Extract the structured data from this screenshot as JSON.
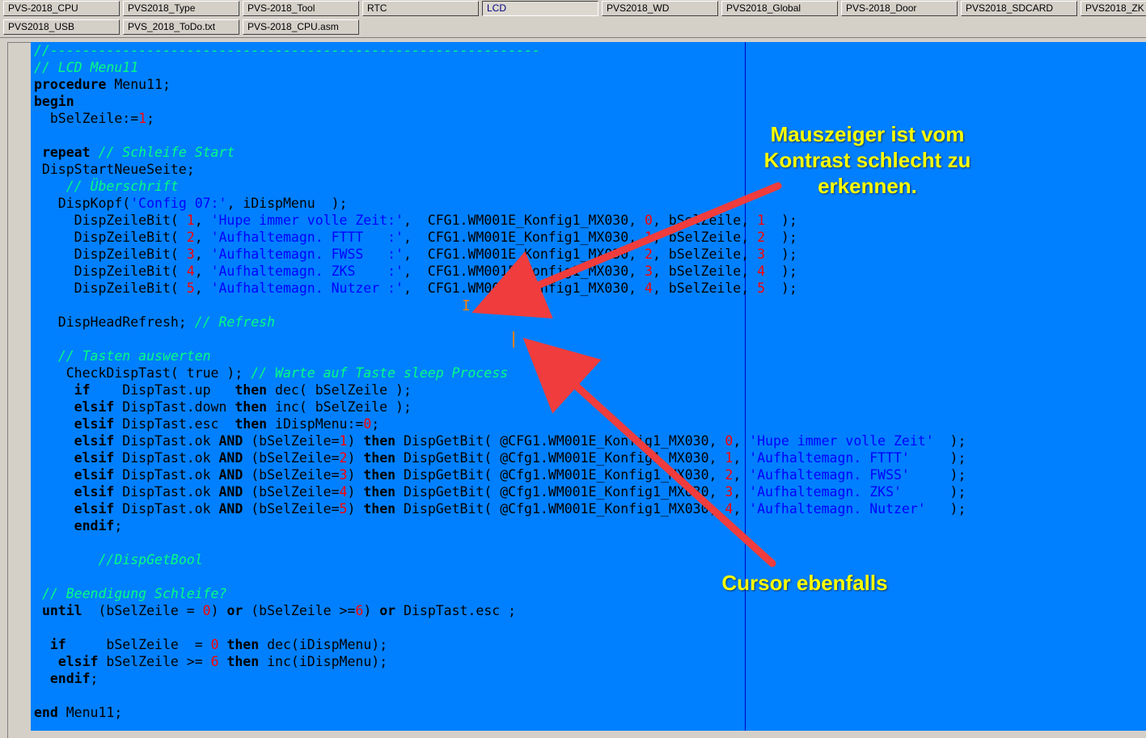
{
  "tabs_row1": [
    "PVS-2018_CPU",
    "PVS2018_Type",
    "PVS-2018_Tool",
    "RTC",
    "LCD",
    "PVS2018_WD",
    "PVS2018_Global",
    "PVS-2018_Door",
    "PVS2018_SDCARD",
    "PVS2018_ZK"
  ],
  "tabs_row2": [
    "PVS2018_USB",
    "PVS_2018_ToDo.txt",
    "PVS-2018_CPU.asm"
  ],
  "active_tab": "LCD",
  "code_lines": [
    [
      [
        "cm",
        "//-------------------------------------------------------------"
      ]
    ],
    [
      [
        "cm",
        "// LCD Menu11"
      ]
    ],
    [
      [
        "kw",
        "procedure"
      ],
      [
        "t",
        " Menu11;"
      ]
    ],
    [
      [
        "kw",
        "begin"
      ]
    ],
    [
      [
        "t",
        "  bSelZeile:="
      ],
      [
        "nm",
        "1"
      ],
      [
        "t",
        ";"
      ]
    ],
    [
      [
        "t",
        ""
      ]
    ],
    [
      [
        "t",
        " "
      ],
      [
        "kw",
        "repeat"
      ],
      [
        "t",
        " "
      ],
      [
        "cm",
        "// Schleife Start"
      ]
    ],
    [
      [
        "t",
        " DispStartNeueSeite;"
      ]
    ],
    [
      [
        "t",
        "    "
      ],
      [
        "cm",
        "// Überschrift"
      ]
    ],
    [
      [
        "t",
        "   DispKopf("
      ],
      [
        "st",
        "'Config 07:'"
      ],
      [
        "t",
        ", iDispMenu  );"
      ]
    ],
    [
      [
        "t",
        "     DispZeileBit( "
      ],
      [
        "nm",
        "1"
      ],
      [
        "t",
        ", "
      ],
      [
        "st",
        "'Hupe immer volle Zeit:'"
      ],
      [
        "t",
        ",  CFG1.WM001E_Konfig1_MX030, "
      ],
      [
        "nm",
        "0"
      ],
      [
        "t",
        ", bSelZeile, "
      ],
      [
        "nm",
        "1"
      ],
      [
        "t",
        "  );"
      ]
    ],
    [
      [
        "t",
        "     DispZeileBit( "
      ],
      [
        "nm",
        "2"
      ],
      [
        "t",
        ", "
      ],
      [
        "st",
        "'Aufhaltemagn. FTTT   :'"
      ],
      [
        "t",
        ",  CFG1.WM001E_Konfig1_MX030, "
      ],
      [
        "nm",
        "1"
      ],
      [
        "t",
        ", bSelZeile, "
      ],
      [
        "nm",
        "2"
      ],
      [
        "t",
        "  );"
      ]
    ],
    [
      [
        "t",
        "     DispZeileBit( "
      ],
      [
        "nm",
        "3"
      ],
      [
        "t",
        ", "
      ],
      [
        "st",
        "'Aufhaltemagn. FWSS   :'"
      ],
      [
        "t",
        ",  CFG1.WM001E_Konfig1_MX030, "
      ],
      [
        "nm",
        "2"
      ],
      [
        "t",
        ", bSelZeile, "
      ],
      [
        "nm",
        "3"
      ],
      [
        "t",
        "  );"
      ]
    ],
    [
      [
        "t",
        "     DispZeileBit( "
      ],
      [
        "nm",
        "4"
      ],
      [
        "t",
        ", "
      ],
      [
        "st",
        "'Aufhaltemagn. ZKS    :'"
      ],
      [
        "t",
        ",  CFG1.WM001E_Konfig1_MX030, "
      ],
      [
        "nm",
        "3"
      ],
      [
        "t",
        ", bSelZeile, "
      ],
      [
        "nm",
        "4"
      ],
      [
        "t",
        "  );"
      ]
    ],
    [
      [
        "t",
        "     DispZeileBit( "
      ],
      [
        "nm",
        "5"
      ],
      [
        "t",
        ", "
      ],
      [
        "st",
        "'Aufhaltemagn. Nutzer :'"
      ],
      [
        "t",
        ",  CFG1.WM001E_Konfig1_MX030, "
      ],
      [
        "nm",
        "4"
      ],
      [
        "t",
        ", bSelZeile, "
      ],
      [
        "nm",
        "5"
      ],
      [
        "t",
        "  );"
      ]
    ],
    [
      [
        "t",
        ""
      ]
    ],
    [
      [
        "t",
        "   DispHeadRefresh; "
      ],
      [
        "cm",
        "// Refresh"
      ]
    ],
    [
      [
        "t",
        ""
      ]
    ],
    [
      [
        "t",
        "   "
      ],
      [
        "cm",
        "// Tasten auswerten"
      ]
    ],
    [
      [
        "t",
        "    CheckDispTast( true ); "
      ],
      [
        "cm",
        "// Warte auf Taste sleep Process"
      ]
    ],
    [
      [
        "t",
        "     "
      ],
      [
        "kw",
        "if"
      ],
      [
        "t",
        "    DispTast.up   "
      ],
      [
        "kw",
        "then"
      ],
      [
        "t",
        " dec( bSelZeile );"
      ]
    ],
    [
      [
        "t",
        "     "
      ],
      [
        "kw",
        "elsif"
      ],
      [
        "t",
        " DispTast.down "
      ],
      [
        "kw",
        "then"
      ],
      [
        "t",
        " inc( bSelZeile );"
      ]
    ],
    [
      [
        "t",
        "     "
      ],
      [
        "kw",
        "elsif"
      ],
      [
        "t",
        " DispTast.esc  "
      ],
      [
        "kw",
        "then"
      ],
      [
        "t",
        " iDispMenu:="
      ],
      [
        "nm",
        "0"
      ],
      [
        "t",
        ";"
      ]
    ],
    [
      [
        "t",
        "     "
      ],
      [
        "kw",
        "elsif"
      ],
      [
        "t",
        " DispTast.ok "
      ],
      [
        "kw",
        "AND"
      ],
      [
        "t",
        " (bSelZeile="
      ],
      [
        "nm",
        "1"
      ],
      [
        "t",
        ") "
      ],
      [
        "kw",
        "then"
      ],
      [
        "t",
        " DispGetBit( @CFG1.WM001E_Konfig1_MX030, "
      ],
      [
        "nm",
        "0"
      ],
      [
        "t",
        ", "
      ],
      [
        "st",
        "'Hupe immer volle Zeit'"
      ],
      [
        "t",
        "  );"
      ]
    ],
    [
      [
        "t",
        "     "
      ],
      [
        "kw",
        "elsif"
      ],
      [
        "t",
        " DispTast.ok "
      ],
      [
        "kw",
        "AND"
      ],
      [
        "t",
        " (bSelZeile="
      ],
      [
        "nm",
        "2"
      ],
      [
        "t",
        ") "
      ],
      [
        "kw",
        "then"
      ],
      [
        "t",
        " DispGetBit( @Cfg1.WM001E_Konfig1_MX030, "
      ],
      [
        "nm",
        "1"
      ],
      [
        "t",
        ", "
      ],
      [
        "st",
        "'Aufhaltemagn. FTTT'"
      ],
      [
        "t",
        "     );"
      ]
    ],
    [
      [
        "t",
        "     "
      ],
      [
        "kw",
        "elsif"
      ],
      [
        "t",
        " DispTast.ok "
      ],
      [
        "kw",
        "AND"
      ],
      [
        "t",
        " (bSelZeile="
      ],
      [
        "nm",
        "3"
      ],
      [
        "t",
        ") "
      ],
      [
        "kw",
        "then"
      ],
      [
        "t",
        " DispGetBit( @Cfg1.WM001E_Konfig1_MX030, "
      ],
      [
        "nm",
        "2"
      ],
      [
        "t",
        ", "
      ],
      [
        "st",
        "'Aufhaltemagn. FWSS'"
      ],
      [
        "t",
        "     );"
      ]
    ],
    [
      [
        "t",
        "     "
      ],
      [
        "kw",
        "elsif"
      ],
      [
        "t",
        " DispTast.ok "
      ],
      [
        "kw",
        "AND"
      ],
      [
        "t",
        " (bSelZeile="
      ],
      [
        "nm",
        "4"
      ],
      [
        "t",
        ") "
      ],
      [
        "kw",
        "then"
      ],
      [
        "t",
        " DispGetBit( @Cfg1.WM001E_Konfig1_MX030, "
      ],
      [
        "nm",
        "3"
      ],
      [
        "t",
        ", "
      ],
      [
        "st",
        "'Aufhaltemagn. ZKS'"
      ],
      [
        "t",
        "      );"
      ]
    ],
    [
      [
        "t",
        "     "
      ],
      [
        "kw",
        "elsif"
      ],
      [
        "t",
        " DispTast.ok "
      ],
      [
        "kw",
        "AND"
      ],
      [
        "t",
        " (bSelZeile="
      ],
      [
        "nm",
        "5"
      ],
      [
        "t",
        ") "
      ],
      [
        "kw",
        "then"
      ],
      [
        "t",
        " DispGetBit( @Cfg1.WM001E_Konfig1_MX030, "
      ],
      [
        "nm",
        "4"
      ],
      [
        "t",
        ", "
      ],
      [
        "st",
        "'Aufhaltemagn. Nutzer'"
      ],
      [
        "t",
        "   );"
      ]
    ],
    [
      [
        "t",
        "     "
      ],
      [
        "kw",
        "endif"
      ],
      [
        "t",
        ";"
      ]
    ],
    [
      [
        "t",
        ""
      ]
    ],
    [
      [
        "t",
        "        "
      ],
      [
        "cm",
        "//DispGetBool"
      ]
    ],
    [
      [
        "t",
        ""
      ]
    ],
    [
      [
        "t",
        " "
      ],
      [
        "cm",
        "// Beendigung Schleife?"
      ]
    ],
    [
      [
        "t",
        " "
      ],
      [
        "kw",
        "until"
      ],
      [
        "t",
        "  (bSelZeile = "
      ],
      [
        "nm",
        "0"
      ],
      [
        "t",
        ") "
      ],
      [
        "kw",
        "or"
      ],
      [
        "t",
        " (bSelZeile >="
      ],
      [
        "nm",
        "6"
      ],
      [
        "t",
        ") "
      ],
      [
        "kw",
        "or"
      ],
      [
        "t",
        " DispTast.esc ;"
      ]
    ],
    [
      [
        "t",
        ""
      ]
    ],
    [
      [
        "t",
        "  "
      ],
      [
        "kw",
        "if"
      ],
      [
        "t",
        "     bSelZeile  = "
      ],
      [
        "nm",
        "0"
      ],
      [
        "t",
        " "
      ],
      [
        "kw",
        "then"
      ],
      [
        "t",
        " dec(iDispMenu);"
      ]
    ],
    [
      [
        "t",
        "   "
      ],
      [
        "kw",
        "elsif"
      ],
      [
        "t",
        " bSelZeile >= "
      ],
      [
        "nm",
        "6"
      ],
      [
        "t",
        " "
      ],
      [
        "kw",
        "then"
      ],
      [
        "t",
        " inc(iDispMenu);"
      ]
    ],
    [
      [
        "t",
        "  "
      ],
      [
        "kw",
        "endif"
      ],
      [
        "t",
        ";"
      ]
    ],
    [
      [
        "t",
        ""
      ]
    ],
    [
      [
        "kw",
        "end"
      ],
      [
        "t",
        " Menu11;"
      ]
    ]
  ],
  "annotations": {
    "mouse": "Mauszeiger ist vom\nKontrast schlecht zu\nerkennen.",
    "cursor": "Cursor ebenfalls"
  },
  "colors": {
    "editor_bg": "#0080ff",
    "comment": "#00ff80",
    "string": "#0000ff",
    "number": "#ff0000",
    "annotation": "#ffff00",
    "arrow": "#f03c3c"
  }
}
